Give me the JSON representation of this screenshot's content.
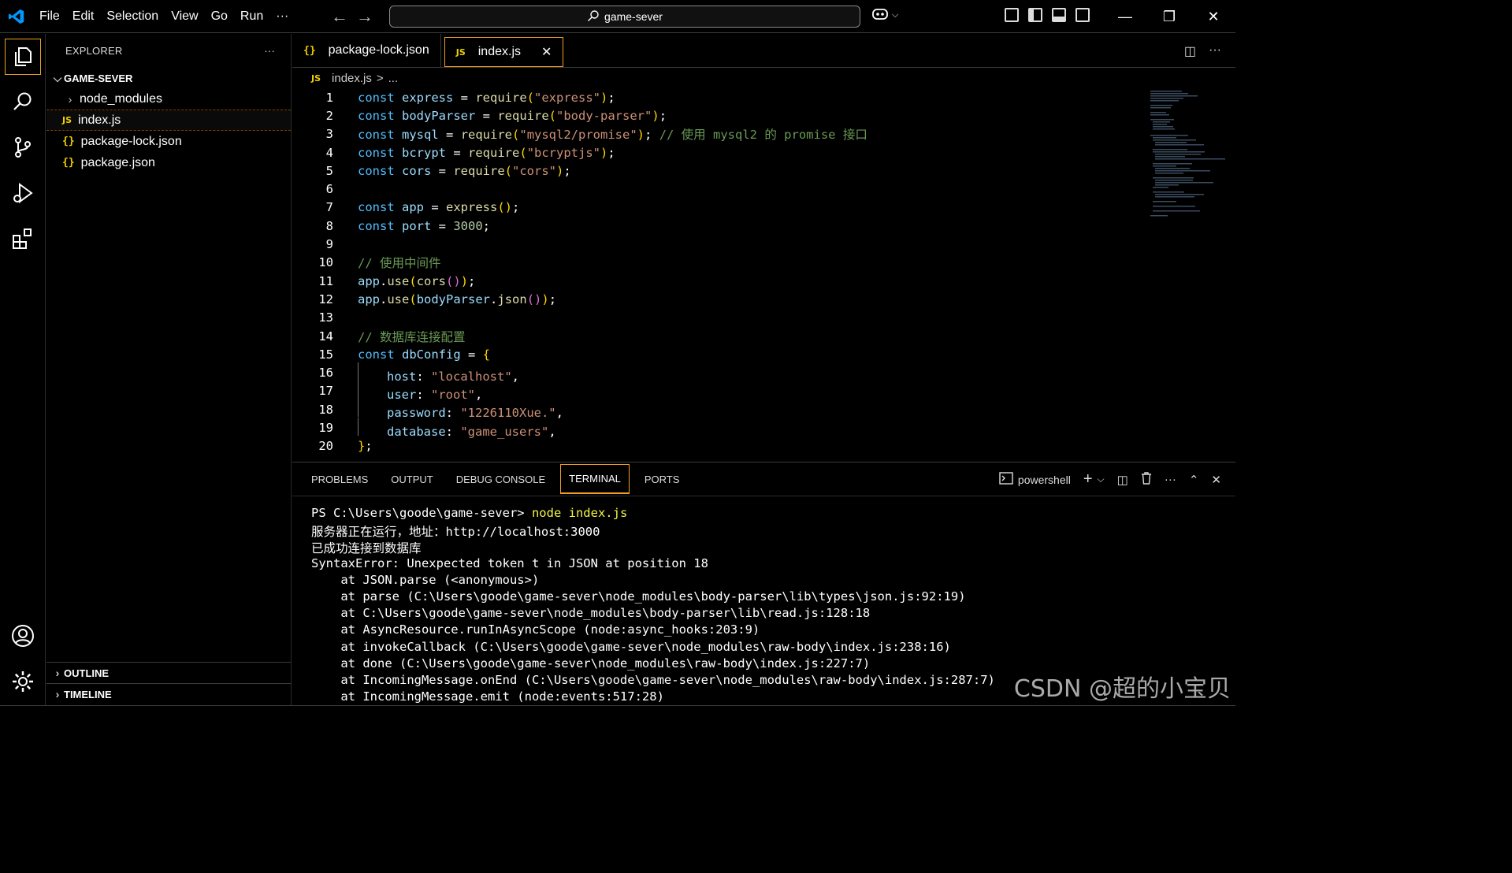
{
  "titlebar": {
    "menu": [
      "File",
      "Edit",
      "Selection",
      "View",
      "Go",
      "Run",
      "···"
    ],
    "search": "game-sever"
  },
  "sidebar": {
    "title": "EXPLORER",
    "more": "···",
    "folder": "GAME-SEVER",
    "items": [
      {
        "label": "node_modules",
        "type": "folder"
      },
      {
        "label": "index.js",
        "type": "js"
      },
      {
        "label": "package-lock.json",
        "type": "json"
      },
      {
        "label": "package.json",
        "type": "json"
      }
    ],
    "outline": "OUTLINE",
    "timeline": "TIMELINE"
  },
  "tabs": [
    {
      "label": "package-lock.json",
      "icon": "{}"
    },
    {
      "label": "index.js",
      "icon": "JS",
      "close": "✕"
    }
  ],
  "breadcrumb": {
    "file": "index.js",
    "sep": ">",
    "rest": "..."
  },
  "editor": {
    "line_numbers": [
      "1",
      "2",
      "3",
      "4",
      "5",
      "6",
      "7",
      "8",
      "9",
      "10",
      "11",
      "12",
      "13",
      "14",
      "15",
      "16",
      "17",
      "18",
      "19",
      "20"
    ],
    "comments": {
      "l3": "// 使用 mysql2 的 promise 接口",
      "l10": "// 使用中间件",
      "l14": "// 数据库连接配置"
    }
  },
  "panel": {
    "tabs": [
      "PROBLEMS",
      "OUTPUT",
      "DEBUG CONSOLE",
      "TERMINAL",
      "PORTS"
    ],
    "shell": "powershell",
    "terminal": {
      "prompt": "PS C:\\Users\\goode\\game-sever> ",
      "command": "node index.js",
      "lines": [
        "服务器正在运行，地址：http://localhost:3000",
        "已成功连接到数据库",
        "SyntaxError: Unexpected token t in JSON at position 18",
        "    at JSON.parse (<anonymous>)",
        "    at parse (C:\\Users\\goode\\game-sever\\node_modules\\body-parser\\lib\\types\\json.js:92:19)",
        "    at C:\\Users\\goode\\game-sever\\node_modules\\body-parser\\lib\\read.js:128:18",
        "    at AsyncResource.runInAsyncScope (node:async_hooks:203:9)",
        "    at invokeCallback (C:\\Users\\goode\\game-sever\\node_modules\\raw-body\\index.js:238:16)",
        "    at done (C:\\Users\\goode\\game-sever\\node_modules\\raw-body\\index.js:227:7)",
        "    at IncomingMessage.onEnd (C:\\Users\\goode\\game-sever\\node_modules\\raw-body\\index.js:287:7)",
        "    at IncomingMessage.emit (node:events:517:28)"
      ]
    }
  },
  "watermark": "CSDN @超的小宝贝",
  "colors": {
    "accent": "#f0a020",
    "vscode_blue": "#0098ff"
  }
}
